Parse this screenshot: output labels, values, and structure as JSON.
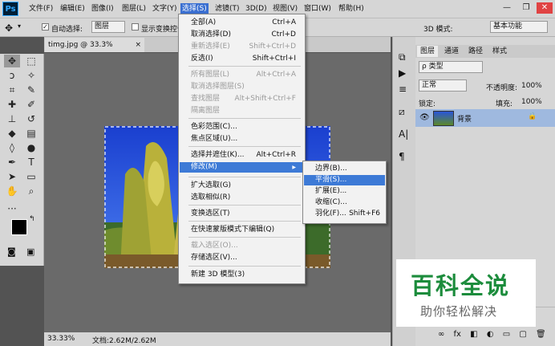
{
  "app": {
    "logo": "Ps"
  },
  "menubar": {
    "items": [
      "文件(F)",
      "编辑(E)",
      "图像(I)",
      "图层(L)",
      "文字(Y)",
      "选择(S)",
      "滤镜(T)",
      "3D(D)",
      "视图(V)",
      "窗口(W)",
      "帮助(H)"
    ],
    "active": "选择(S)"
  },
  "window_controls": {
    "minimize": "—",
    "restore": "❐",
    "close": "✕"
  },
  "options_bar": {
    "auto_select_label": "自动选择:",
    "auto_select_target": "图层",
    "show_transform_label": "显示变换控件",
    "mode_3d_label": "3D 模式:",
    "workspace": "基本功能"
  },
  "document": {
    "tab_title": "timg.jpg @ 33.3%(RGB/8#)",
    "tab_close": "×",
    "zoom": "33.33%",
    "doc_info": "文档:2.62M/2.62M"
  },
  "select_menu": {
    "items": [
      {
        "label": "全部(A)",
        "shortcut": "Ctrl+A",
        "disabled": false
      },
      {
        "label": "取消选择(D)",
        "shortcut": "Ctrl+D",
        "disabled": false
      },
      {
        "label": "重新选择(E)",
        "shortcut": "Shift+Ctrl+D",
        "disabled": true
      },
      {
        "label": "反选(I)",
        "shortcut": "Shift+Ctrl+I",
        "disabled": false
      },
      {
        "label": "所有图层(L)",
        "shortcut": "Alt+Ctrl+A",
        "disabled": true
      },
      {
        "label": "取消选择图层(S)",
        "shortcut": "",
        "disabled": true
      },
      {
        "label": "查找图层",
        "shortcut": "Alt+Shift+Ctrl+F",
        "disabled": true
      },
      {
        "label": "隔离图层",
        "shortcut": "",
        "disabled": true
      },
      {
        "label": "色彩范围(C)...",
        "shortcut": "",
        "disabled": false
      },
      {
        "label": "焦点区域(U)...",
        "shortcut": "",
        "disabled": false
      },
      {
        "label": "选择并遮住(K)...",
        "shortcut": "Alt+Ctrl+R",
        "disabled": false
      },
      {
        "label": "修改(M)",
        "shortcut": "",
        "disabled": false
      },
      {
        "label": "扩大选取(G)",
        "shortcut": "",
        "disabled": false
      },
      {
        "label": "选取相似(R)",
        "shortcut": "",
        "disabled": false
      },
      {
        "label": "变换选区(T)",
        "shortcut": "",
        "disabled": false
      },
      {
        "label": "在快速蒙版模式下编辑(Q)",
        "shortcut": "",
        "disabled": false
      },
      {
        "label": "载入选区(O)...",
        "shortcut": "",
        "disabled": true
      },
      {
        "label": "存储选区(V)...",
        "shortcut": "",
        "disabled": false
      },
      {
        "label": "新建 3D 模型(3)",
        "shortcut": "",
        "disabled": false
      }
    ],
    "submenu_arrow": "▶"
  },
  "modify_submenu": {
    "items": [
      {
        "label": "边界(B)...",
        "shortcut": ""
      },
      {
        "label": "平滑(S)...",
        "shortcut": ""
      },
      {
        "label": "扩展(E)...",
        "shortcut": ""
      },
      {
        "label": "收缩(C)...",
        "shortcut": ""
      },
      {
        "label": "羽化(F)...",
        "shortcut": "Shift+F6"
      }
    ],
    "highlighted": "平滑(S)..."
  },
  "layers_panel": {
    "tabs": [
      "图层",
      "通道",
      "路径",
      "样式"
    ],
    "search_placeholder": "ρ 类型",
    "blend_mode": "正常",
    "opacity_label": "不透明度:",
    "opacity_value": "100%",
    "lock_label": "锁定:",
    "fill_label": "填充:",
    "fill_value": "100%",
    "layer_name": "背景",
    "footer_icons": [
      "∞",
      "fx",
      "◧",
      "◐",
      "▭",
      "▢",
      "🗑"
    ]
  },
  "watermark": {
    "title": "百科全说",
    "subtitle": "助你轻松解决"
  }
}
